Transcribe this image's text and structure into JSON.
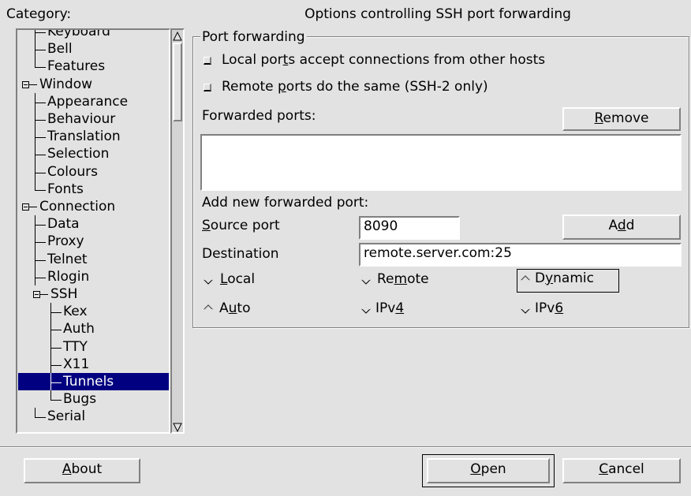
{
  "category_label": "Category:",
  "panel_title": "Options controlling SSH port forwarding",
  "tree": [
    {
      "label": "Keyboard",
      "indent": 1,
      "partial": true
    },
    {
      "label": "Bell",
      "indent": 1
    },
    {
      "label": "Features",
      "indent": 1,
      "last": true
    },
    {
      "label": "Window",
      "indent": 0,
      "expanded": true
    },
    {
      "label": "Appearance",
      "indent": 1
    },
    {
      "label": "Behaviour",
      "indent": 1
    },
    {
      "label": "Translation",
      "indent": 1
    },
    {
      "label": "Selection",
      "indent": 1
    },
    {
      "label": "Colours",
      "indent": 1
    },
    {
      "label": "Fonts",
      "indent": 1,
      "last": true
    },
    {
      "label": "Connection",
      "indent": 0,
      "expanded": true
    },
    {
      "label": "Data",
      "indent": 1
    },
    {
      "label": "Proxy",
      "indent": 1
    },
    {
      "label": "Telnet",
      "indent": 1
    },
    {
      "label": "Rlogin",
      "indent": 1
    },
    {
      "label": "SSH",
      "indent": 1,
      "expanded": true
    },
    {
      "label": "Kex",
      "indent": 2
    },
    {
      "label": "Auth",
      "indent": 2
    },
    {
      "label": "TTY",
      "indent": 2
    },
    {
      "label": "X11",
      "indent": 2
    },
    {
      "label": "Tunnels",
      "indent": 2,
      "selected": true
    },
    {
      "label": "Bugs",
      "indent": 2,
      "last": true
    },
    {
      "label": "Serial",
      "indent": 1,
      "last": true
    }
  ],
  "group": {
    "title": "Port forwarding",
    "local_accept": {
      "label_pre": "Local por",
      "label_key": "t",
      "label_post": "s accept connections from other hosts",
      "checked": false
    },
    "remote_same": {
      "label_pre": "Remote ",
      "label_key": "p",
      "label_post": "orts do the same (SSH-2 only)",
      "checked": false
    },
    "forwarded_label": "Forwarded ports:",
    "remove_button": {
      "pre": "",
      "key": "R",
      "post": "emove"
    },
    "forwarded_list": [],
    "add_new_label": "Add new forwarded port:",
    "source_label": {
      "pre": "",
      "key": "S",
      "post": "ource port"
    },
    "source_value": "8090",
    "add_button": {
      "pre": "A",
      "key": "d",
      "post": "d"
    },
    "destination_label": "Destination",
    "destination_value": "remote.server.com:25",
    "direction": [
      {
        "pre": "",
        "key": "L",
        "post": "ocal",
        "selected": false
      },
      {
        "pre": "Re",
        "key": "m",
        "post": "ote",
        "selected": false
      },
      {
        "pre": "D",
        "key": "y",
        "post": "namic",
        "selected": true
      }
    ],
    "ipversion": [
      {
        "pre": "A",
        "key": "u",
        "post": "to",
        "selected": true
      },
      {
        "pre": "IPv",
        "key": "4",
        "post": "",
        "selected": false
      },
      {
        "pre": "IPv",
        "key": "6",
        "post": "",
        "selected": false
      }
    ]
  },
  "buttons": {
    "about": {
      "pre": "",
      "key": "A",
      "post": "bout"
    },
    "open": {
      "pre": "",
      "key": "O",
      "post": "pen"
    },
    "cancel": {
      "pre": "",
      "key": "C",
      "post": "ancel"
    }
  },
  "colors": {
    "background": "#e2e2e2",
    "selection": "#000080"
  }
}
